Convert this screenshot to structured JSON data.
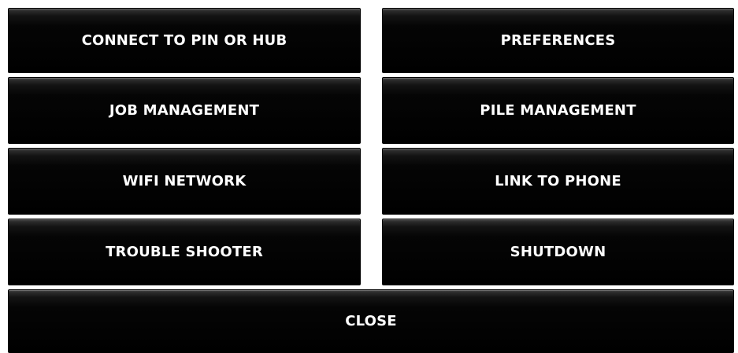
{
  "menu": {
    "connect_label": "CONNECT TO PIN OR HUB",
    "preferences_label": "PREFERENCES",
    "job_management_label": "JOB MANAGEMENT",
    "pile_management_label": "PILE MANAGEMENT",
    "wifi_network_label": "WIFI NETWORK",
    "link_to_phone_label": "LINK TO PHONE",
    "trouble_shooter_label": "TROUBLE SHOOTER",
    "shutdown_label": "SHUTDOWN",
    "close_label": "CLOSE"
  },
  "colors": {
    "button_background": "#000000",
    "button_text": "#ffffff",
    "page_background": "#ffffff"
  }
}
